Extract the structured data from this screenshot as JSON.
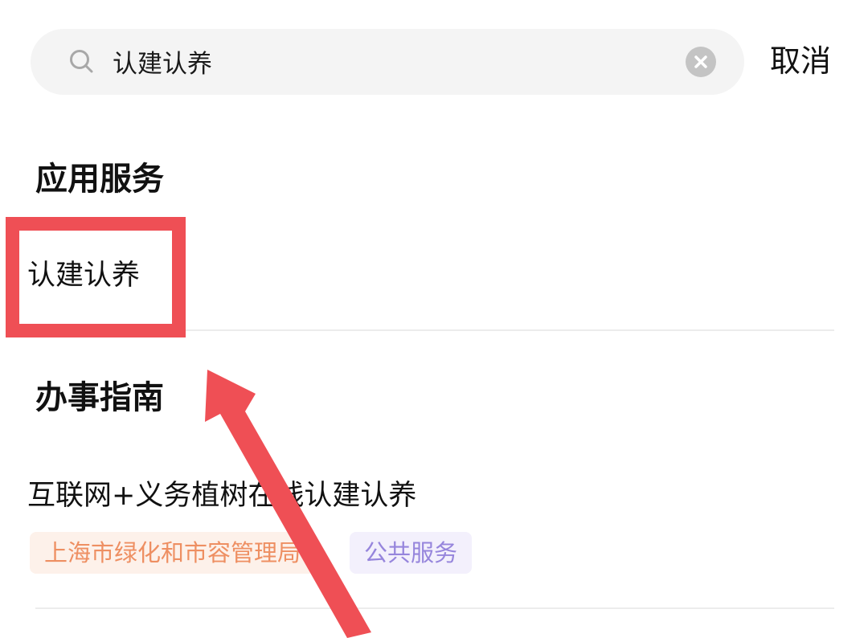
{
  "search": {
    "value": "认建认养",
    "cancel_label": "取消",
    "icon": "search-icon",
    "clear_icon": "clear-icon"
  },
  "sections": {
    "apps": {
      "title": "应用服务",
      "items": [
        {
          "label": "认建认养"
        }
      ]
    },
    "guides": {
      "title": "办事指南",
      "items": [
        {
          "title": "互联网+义务植树在线认建认养",
          "tags": [
            "上海市绿化和市容管理局",
            "公共服务"
          ]
        }
      ]
    }
  },
  "annotation": {
    "highlight_color": "#ef4f55",
    "arrow_color": "#ef4f55"
  },
  "colors": {
    "search_background": "#f4f4f4",
    "tag_org_background": "#fdf1ea",
    "tag_org_text": "#ee8f62",
    "tag_type_background": "#f3f0fc",
    "tag_type_text": "#9685dc"
  }
}
